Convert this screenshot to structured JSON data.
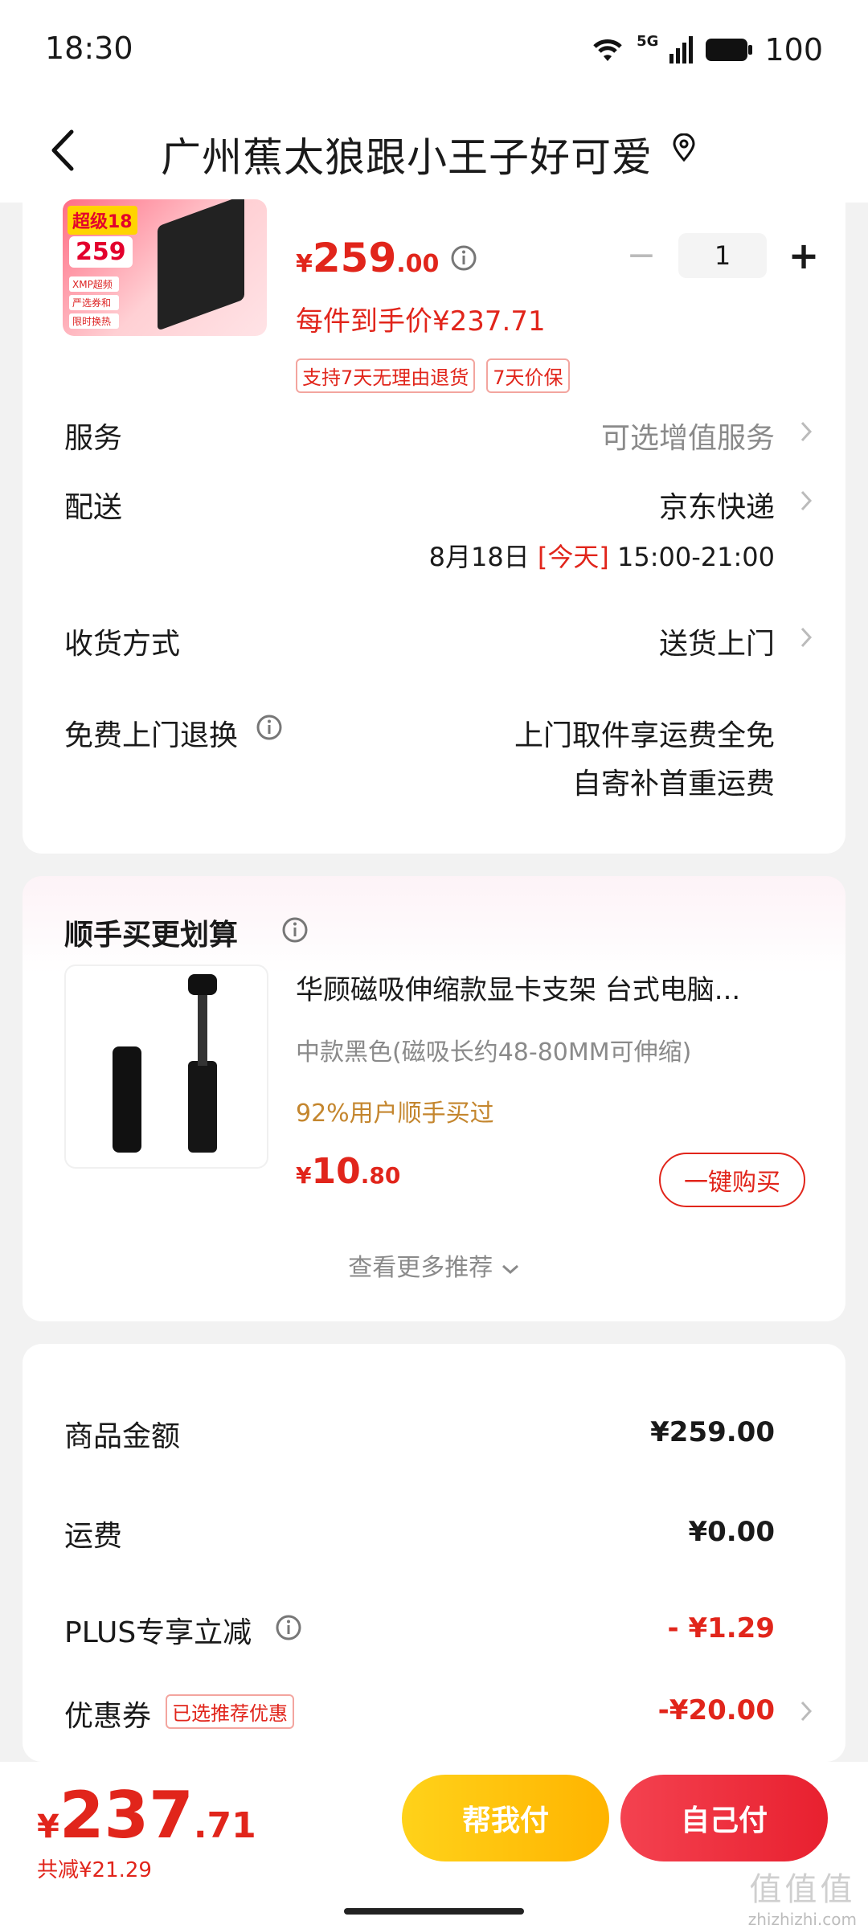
{
  "status_bar": {
    "time": "18:30",
    "network": "5G",
    "battery": "100"
  },
  "header": {
    "title": "广州蕉太狼跟小王子好可爱"
  },
  "product": {
    "image_badge_top": "超级18",
    "image_badge_price": "259",
    "image_chips": [
      "XMP超频",
      "严选券和",
      "限时换热"
    ],
    "price_yen": "¥",
    "price_int": "259",
    "price_dec": ".00",
    "quantity": "1",
    "each_price": "每件到手价¥237.71",
    "tags": [
      "支持7天无理由退货",
      "7天价保"
    ]
  },
  "rows": {
    "service_label": "服务",
    "service_value": "可选增值服务",
    "delivery_label": "配送",
    "delivery_value": "京东快递",
    "delivery_date": "8月18日",
    "delivery_today": "[今天]",
    "delivery_time": "15:00-21:00",
    "receive_label": "收货方式",
    "receive_value": "送货上门",
    "return_label": "免费上门退换",
    "return_value_1": "上门取件享运费全免",
    "return_value_2": "自寄补首重运费"
  },
  "recommend": {
    "title": "顺手买更划算",
    "item_title": "华顾磁吸伸缩款显卡支架 台式电脑...",
    "item_spec": "中款黑色(磁吸长约48-80MM可伸缩)",
    "item_bought": "92%用户顺手买过",
    "price_yen": "¥",
    "price_int": "10",
    "price_dec": ".80",
    "buy_label": "一键购买",
    "more_label": "查看更多推荐"
  },
  "summary": {
    "goods_label": "商品金额",
    "goods_value": "¥259.00",
    "shipping_label": "运费",
    "shipping_value": "¥0.00",
    "plus_label": "PLUS专享立减",
    "plus_value": "- ¥1.29",
    "coupon_label": "优惠券",
    "coupon_tag": "已选推荐优惠",
    "coupon_value": "-¥20.00"
  },
  "bottom": {
    "total_yen": "¥",
    "total_int": "237",
    "total_dec": ".71",
    "saved": "共减¥21.29",
    "help_pay": "帮我付",
    "self_pay": "自己付"
  },
  "watermark": {
    "text": "值值值",
    "site": "zhizhizhi.com"
  },
  "colors": {
    "accent_red": "#e1251b",
    "yellow": "#ffc107",
    "gold_text": "#c4862e"
  }
}
